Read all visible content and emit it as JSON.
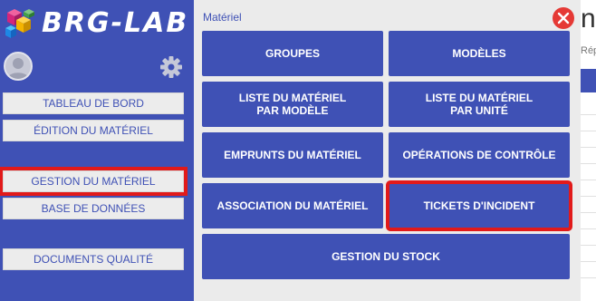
{
  "brand": {
    "name": "BRG-LAB"
  },
  "sidebar": {
    "items": [
      {
        "label": "TABLEAU DE BORD"
      },
      {
        "label": "ÉDITION DU MATÉRIEL"
      },
      {
        "label": "GESTION DU MATÉRIEL",
        "selected": true
      },
      {
        "label": "BASE DE DONNÉES"
      },
      {
        "label": "DOCUMENTS QUALITÉ"
      }
    ]
  },
  "panel": {
    "title": "Matériel",
    "tiles": [
      {
        "label": "GROUPES"
      },
      {
        "label": "MODÈLES"
      },
      {
        "label": "LISTE DU MATÉRIEL\nPAR MODÈLE"
      },
      {
        "label": "LISTE DU MATÉRIEL\nPAR UNITÉ"
      },
      {
        "label": "EMPRUNTS DU MATÉRIEL"
      },
      {
        "label": "OPÉRATIONS DE CONTRÔLE"
      },
      {
        "label": "ASSOCIATION DU MATÉRIEL"
      },
      {
        "label": "TICKETS D'INCIDENT",
        "selected": true
      },
      {
        "label": "GESTION DU STOCK"
      }
    ]
  },
  "background": {
    "title_fragment": "n",
    "subtitle_fragment": "Rép"
  },
  "colors": {
    "primary": "#3f51b5",
    "highlight": "#e11a1a",
    "close": "#e53935",
    "panel_bg": "#ebebeb"
  },
  "icons": {
    "avatar": "user-avatar-icon",
    "settings": "gear-icon",
    "close": "close-icon",
    "logo": "cubes-logo-icon"
  }
}
